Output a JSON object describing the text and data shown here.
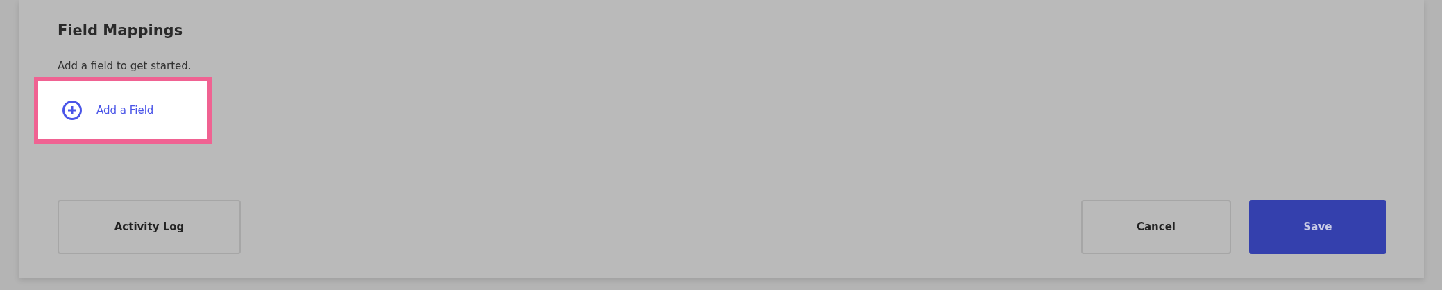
{
  "section": {
    "title": "Field Mappings",
    "hint": "Add a field to get started.",
    "add_button": {
      "label": "Add a Field",
      "highlighted": true
    }
  },
  "footer": {
    "left_buttons": [
      {
        "label": "Activity Log",
        "kind": "secondary"
      }
    ],
    "right_buttons": [
      {
        "label": "Cancel",
        "kind": "secondary"
      },
      {
        "label": "Save",
        "kind": "primary"
      }
    ]
  }
}
